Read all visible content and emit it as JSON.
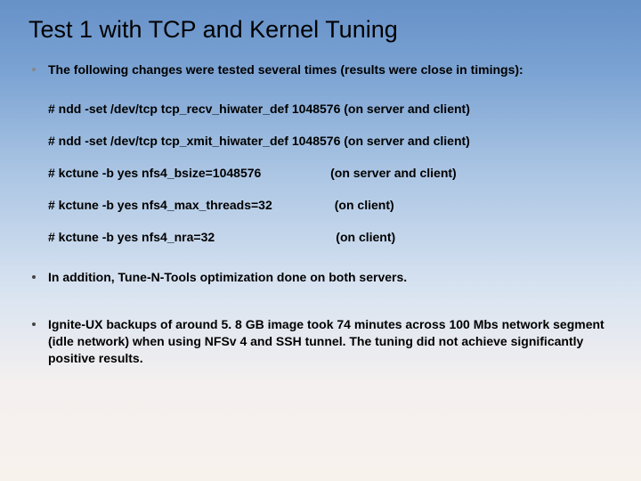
{
  "title": "Test 1 with TCP and Kernel Tuning",
  "intro": "The following changes were tested several times (results were close in timings):",
  "commands": [
    {
      "text": "# ndd -set /dev/tcp tcp_recv_hiwater_def 1048576 (on server and client)"
    },
    {
      "text": "# ndd -set /dev/tcp tcp_xmit_hiwater_def 1048576 (on server and client)"
    },
    {
      "cmd": "# kctune -b yes nfs4_bsize=1048576",
      "note": "(on server and client)",
      "pad": "                    "
    },
    {
      "cmd": "# kctune -b yes nfs4_max_threads=32",
      "note": "(on client)",
      "pad": "                  "
    },
    {
      "cmd": "# kctune -b yes nfs4_nra=32",
      "note": "(on client)",
      "pad": "                                   "
    }
  ],
  "addition": "In addition, Tune-N-Tools optimization done on both servers.",
  "result": "Ignite-UX backups of around 5. 8 GB image took 74 minutes across 100 Mbs network segment (idle network) when using NFSv 4 and SSH tunnel. The tuning did not achieve significantly positive results."
}
